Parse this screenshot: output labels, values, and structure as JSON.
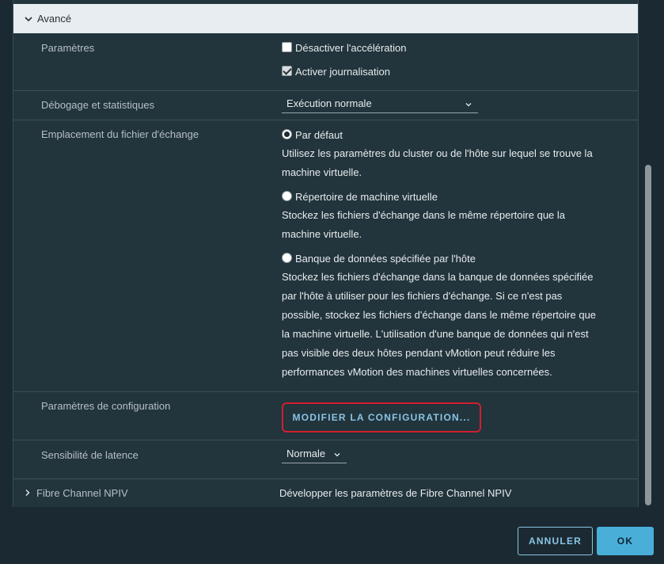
{
  "section": {
    "title": "Avancé",
    "expanded": true
  },
  "params": {
    "label": "Paramètres",
    "disable_accel": {
      "label": "Désactiver l'accélération",
      "checked": false
    },
    "enable_logging": {
      "label": "Activer journalisation",
      "checked": true
    }
  },
  "debug": {
    "label": "Débogage et statistiques",
    "value": "Exécution normale"
  },
  "swap": {
    "label": "Emplacement du fichier d'échange",
    "options": [
      {
        "label": "Par défaut",
        "selected": true,
        "description_lines": [
          "Utilisez les paramètres du cluster ou de l'hôte sur lequel se trouve la",
          "machine virtuelle."
        ]
      },
      {
        "label": "Répertoire de machine virtuelle",
        "selected": false,
        "description_lines": [
          "Stockez les fichiers d'échange dans le même répertoire que la",
          "machine virtuelle."
        ]
      },
      {
        "label": "Banque de données spécifiée par l'hôte",
        "selected": false,
        "description_lines": [
          "Stockez les fichiers d'échange dans la banque de données spécifiée",
          "par l'hôte à utiliser pour les fichiers d'échange. Si ce n'est pas",
          "possible, stockez les fichiers d'échange dans le même répertoire que",
          "la machine virtuelle. L'utilisation d'une banque de données qui n'est",
          "pas visible des deux hôtes pendant vMotion peut réduire les",
          "performances vMotion des machines virtuelles concernées."
        ]
      }
    ]
  },
  "config": {
    "label": "Paramètres de configuration",
    "button": "MODIFIER LA CONFIGURATION..."
  },
  "latency": {
    "label": "Sensibilité de latence",
    "value": "Normale"
  },
  "npiv": {
    "label": "Fibre Channel NPIV",
    "value": "Développer les paramètres de Fibre Channel NPIV"
  },
  "footer": {
    "cancel": "ANNULER",
    "ok": "OK"
  },
  "colors": {
    "accent": "#49afd9",
    "highlight_border": "#d11f2e",
    "panel_bg": "#22343c"
  }
}
